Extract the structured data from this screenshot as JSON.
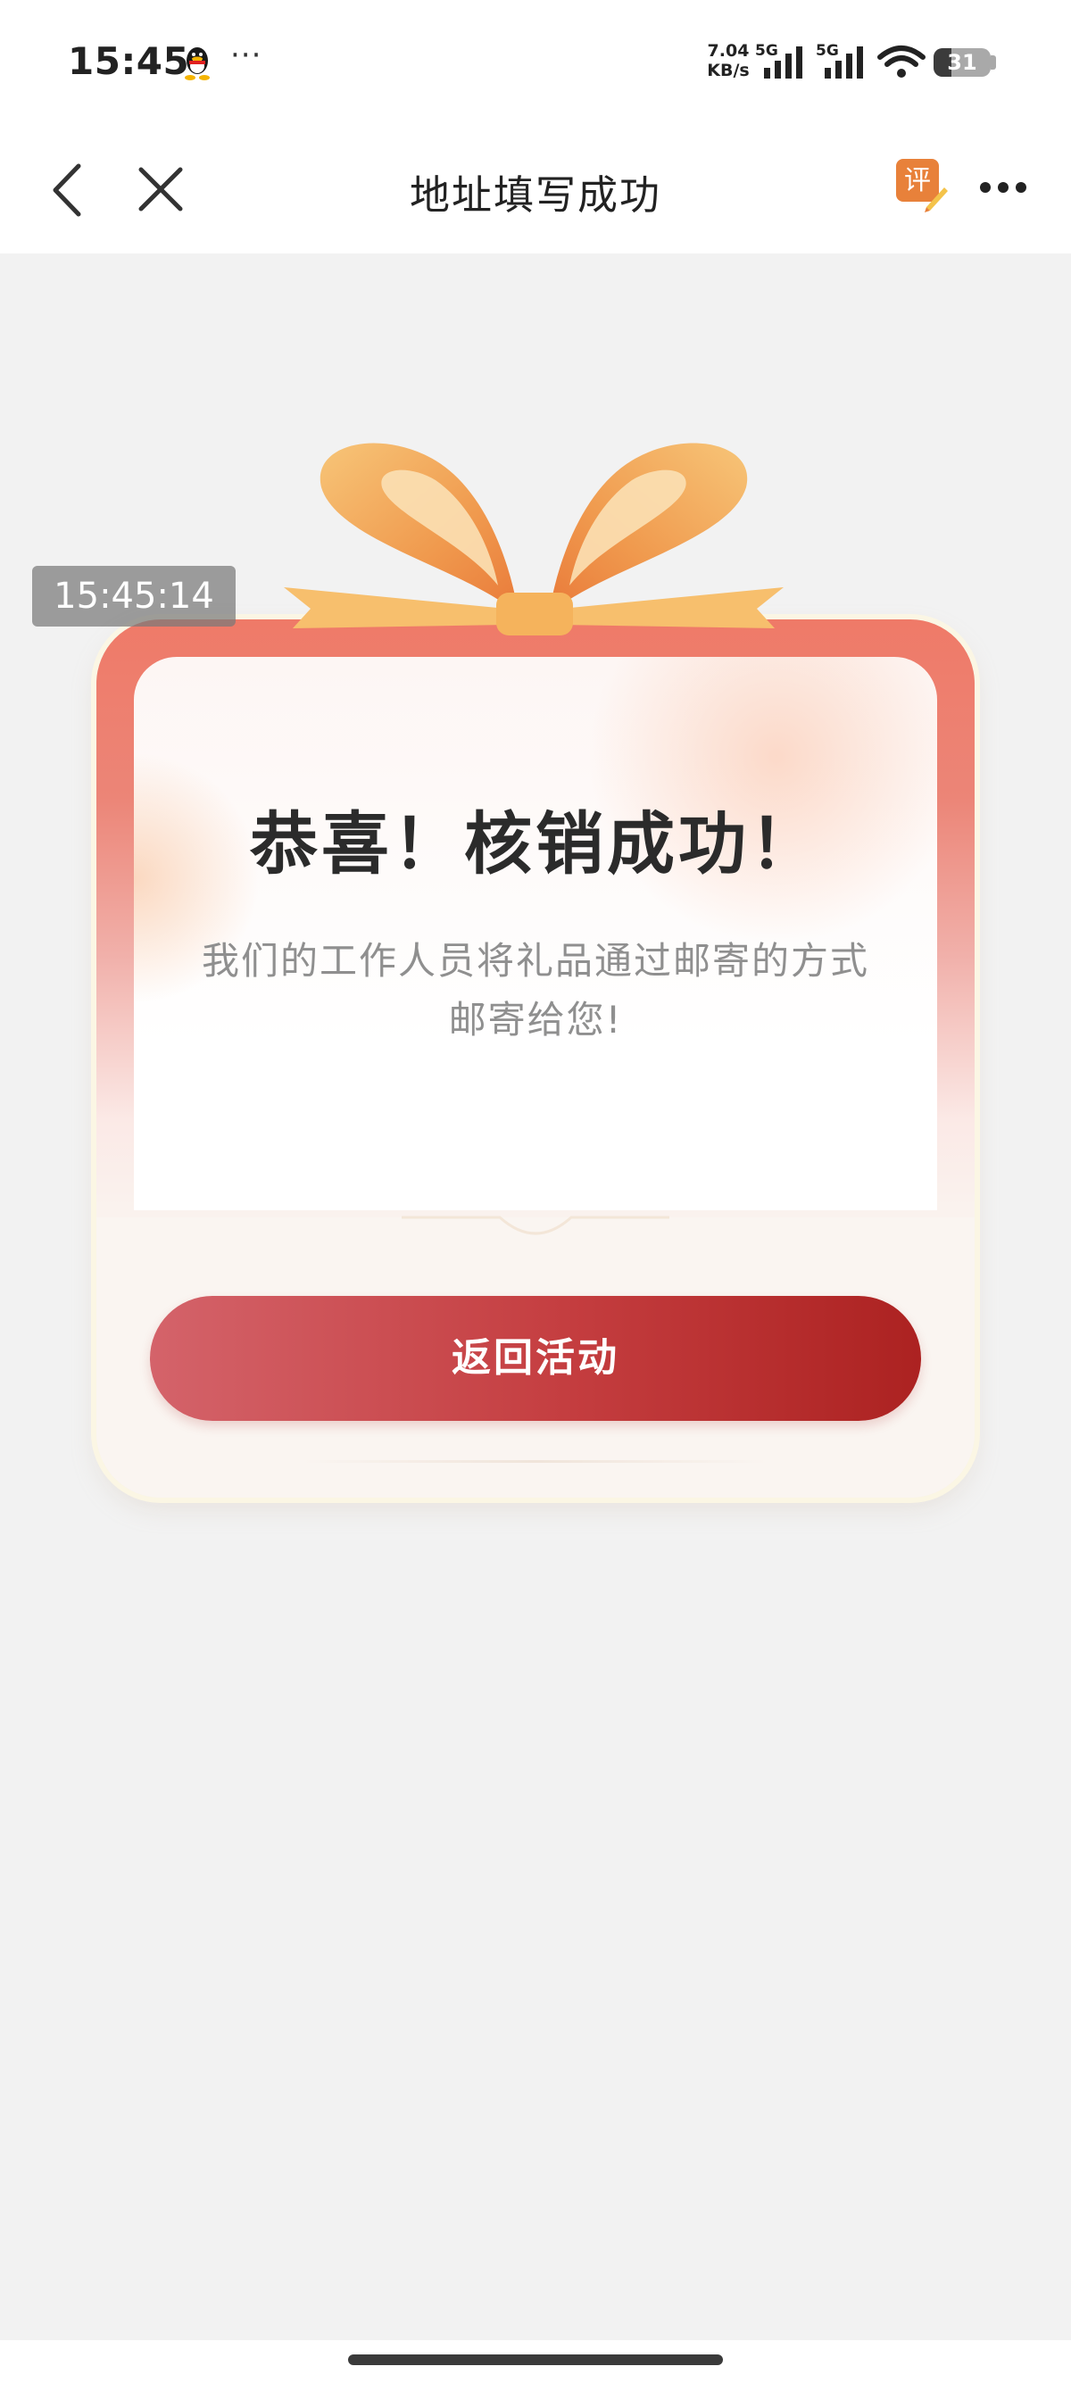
{
  "status_bar": {
    "time": "15:45",
    "dots": "···",
    "net_speed_value": "7.04",
    "net_speed_unit": "KB/s",
    "sim1_label": "5G",
    "sim2_label": "5G",
    "battery_level": "31",
    "battery_fraction": 0.31
  },
  "nav": {
    "title": "地址填写成功",
    "review_label": "评"
  },
  "time_badge": "15:45:14",
  "card": {
    "title": "恭喜！核销成功！",
    "desc_line1": "我们的工作人员将礼品通过邮寄的方式",
    "desc_line2": "邮寄给您!",
    "button_label": "返回活动"
  },
  "colors": {
    "button_start": "#d4636a",
    "button_end": "#ac2221",
    "card_top": "#ef7a68",
    "review_icon": "#e8813a"
  }
}
